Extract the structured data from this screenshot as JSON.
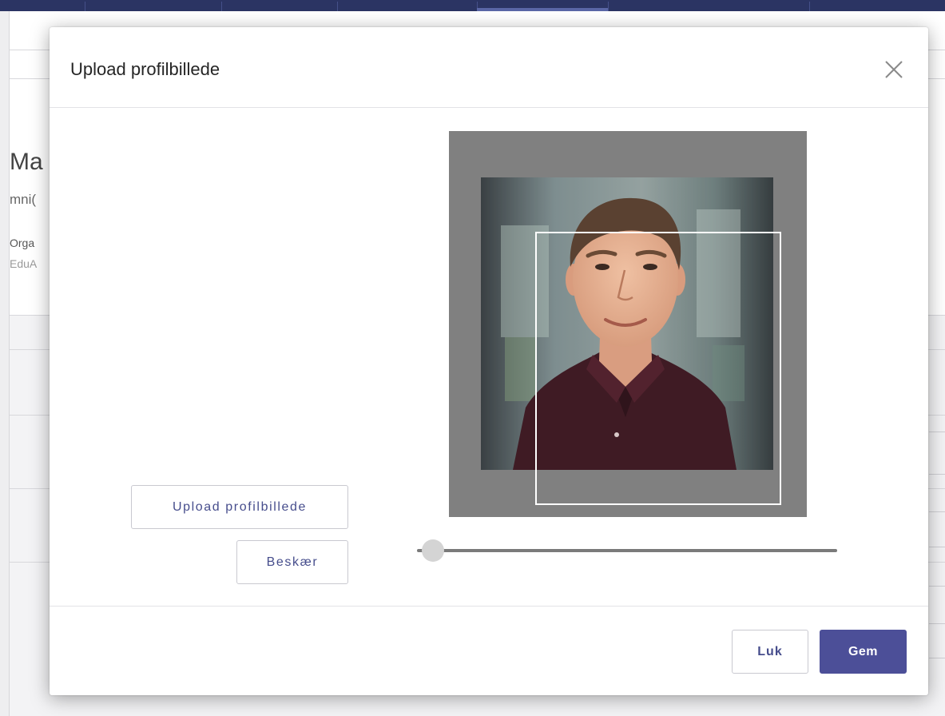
{
  "background": {
    "name_fragment": "Ma",
    "username_fragment": "mni(",
    "org_label_fragment": "Orga",
    "org_value_fragment": "EduA"
  },
  "modal": {
    "title": "Upload profilbillede",
    "close_icon": "close-icon",
    "upload_button_label": "Upload profilbillede",
    "crop_button_label": "Beskær",
    "footer": {
      "close_label": "Luk",
      "save_label": "Gem"
    },
    "zoom_slider": {
      "value": 0.0
    }
  },
  "colors": {
    "primary": "#4c4f98",
    "topbar": "#2b3463",
    "cropper_bg": "#808080"
  }
}
